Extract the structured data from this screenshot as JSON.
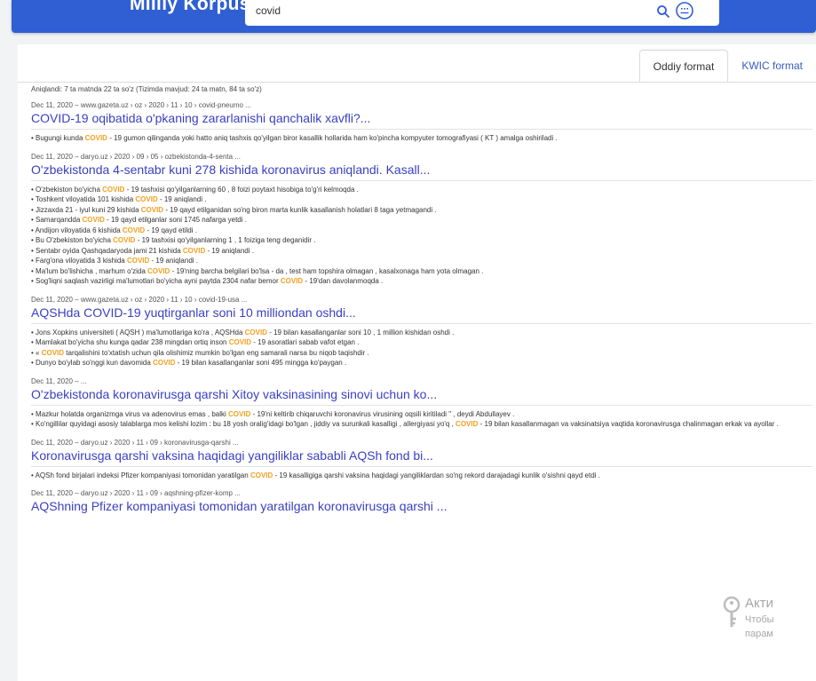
{
  "header": {
    "logo": "Milliy Korpus",
    "search_value": "covid"
  },
  "tabs": [
    {
      "label": "Oddiy format",
      "active": true
    },
    {
      "label": "KWIC format",
      "active": false
    }
  ],
  "summary": "Aniqlandi: 7 ta matnda 22 ta so'z (Tizimda mavjud: 24 ta matn, 84 ta so'z)",
  "highlight_term": "COVID",
  "highlight_color": "#f0a121",
  "results": [
    {
      "meta": "Dec 11, 2020 – www.gazeta.uz › oz › 2020 › 11 › 10 › covid-pneumo ...",
      "title": "COVID-19 oqibatida o'pkaning zararlanishi qanchalik xavfli?...",
      "snippets": [
        "• Bugungi kunda COVID - 19 gumon qilinganda yoki hatto aniq tashxis qo'yilgan biror kasallik hollarida ham ko'pincha kompyuter tomografiyasi ( KT ) amalga oshiriladi ."
      ]
    },
    {
      "meta": "Dec 11, 2020 – daryo.uz › 2020 › 09 › 05 › ozbekistonda-4-senta ...",
      "title": "O'zbekistonda 4-sentabr kuni 278 kishida koronavirus aniqlandi. Kasall...",
      "snippets": [
        "• O'zbekiston bo'yicha COVID - 19 tashxisi qo'yilganlarning 60 , 8 foizi poytaxt hisobiga to'g'ri kelmoqda .",
        "• Toshkent viloyatida 101 kishida COVID - 19 aniqlandi .",
        "• Jizzaxda 21 - iyul kuni 29 kishida COVID - 19 qayd etilganidan so'ng biron marta kunlik kasallanish holatlari 8 taga yetmagandi .",
        "• Samarqandda COVID - 19 qayd etilganlar soni 1745 nafarga yetdi .",
        "• Andijon viloyatida 6 kishida COVID - 19 qayd etildi .",
        "• Bu O'zbekiston bo'yicha COVID - 19 tashxisi qo'yilganlarning 1 , 1 foiziga teng deganidir .",
        "• Sentabr oyida Qashqadaryoda jami 21 kishida COVID - 19 aniqlandi .",
        "• Farg'ona viloyatida 3 kishida COVID - 19 aniqlandi .",
        "• Ma'lum bo'lishicha , marhum o'zida COVID - 19'ning barcha belgilari bo'lsa - da , test ham topshira olmagan , kasalxonaga ham yota olmagan .",
        "• Sog'liqni saqlash vazirligi ma'lumotlari bo'yicha ayni paytda 2304 nafar bemor COVID - 19'dan davolanmoqda ."
      ]
    },
    {
      "meta": "Dec 11, 2020 – www.gazeta.uz › oz › 2020 › 11 › 10 › covid-19-usa ...",
      "title": "AQSHda COVID-19 yuqtirganlar soni 10 milliondan oshdi...",
      "snippets": [
        "• Jons Xopkins universiteti ( AQSH ) ma'lumotlariga ko'ra , AQSHda COVID - 19 bilan kasallanganlar soni 10 , 1 million kishidan oshdi .",
        "• Mamlakat bo'yicha shu kunga qadar 238 mingdan ortiq inson COVID - 19 asoratlari sabab vafot etgan .",
        "• « COVID tarqalishini to'xtatish uchun qila olishimiz mumkin bo'lgan eng samarali narsa bu niqob taqishdir .",
        "• Dunyo bo'ylab so'nggi kun davomida COVID - 19 bilan kasallanganlar soni 495 mingga ko'paygan ."
      ]
    },
    {
      "meta": "Dec 11, 2020 – ...",
      "title": "O'zbekistonda koronavirusga qarshi Xitoy vaksinasining sinovi uchun ko...",
      "snippets": [
        "• Mazkur holatda organizmga virus va adenovirus emas , balki COVID - 19'ni keltirib chiqaruvchi koronavirus virusining oqsili kiritiladi \" , deydi Abdullayev .",
        "• Ko'ngillilar quyidagi asosiy talablarga mos kelishi lozim : bu 18 yosh oralig'idagi bo'lgan , jiddiy va surunkali kasalligi , allergiyasi yo'q , COVID - 19 bilan kasallanmagan va vaksinatsiya vaqtida koronavirusga chalinmagan erkak va ayollar ."
      ]
    },
    {
      "meta": "Dec 11, 2020 – daryo.uz › 2020 › 11 › 09 › koronavirusga-qarshi ...",
      "title": "Koronavirusga qarshi vaksina haqidagi yangiliklar sababli AQSh fond bi...",
      "snippets": [
        "• AQSh fond birjalari indeksi Pfizer kompaniyasi tomonidan yaratilgan COVID - 19 kasalligiga qarshi vaksina haqidagi yangiliklardan so'ng rekord darajadagi kunlik o'sishni qayd etdi ."
      ]
    },
    {
      "meta": "Dec 11, 2020 – daryo.uz › 2020 › 11 › 09 › aqshning-pfizer-komp ...",
      "title": "AQShning Pfizer kompaniyasi tomonidan yaratilgan koronavirusga qarshi ...",
      "snippets": []
    }
  ],
  "watermark": {
    "line1": "Акти",
    "line2": "Чтобы",
    "line3": "парам"
  }
}
